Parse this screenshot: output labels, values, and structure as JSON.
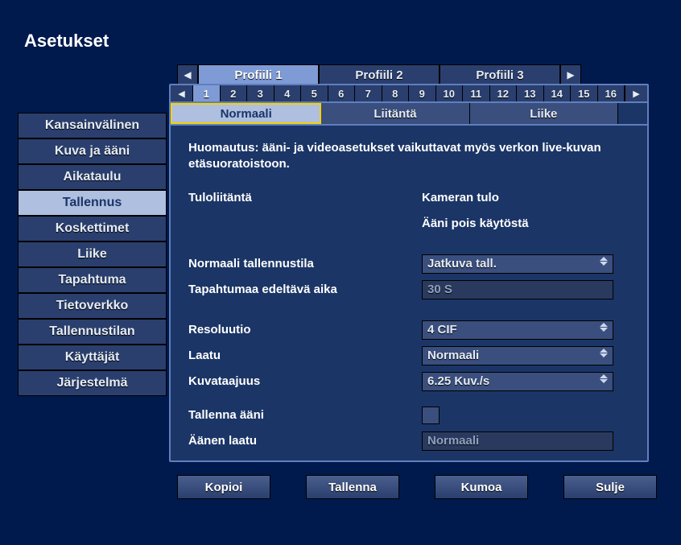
{
  "title": "Asetukset",
  "profiles": {
    "arrow_left": "◀",
    "arrow_right": "▶",
    "tabs": [
      "Profiili 1",
      "Profiili 2",
      "Profiili 3"
    ],
    "active_index": 0
  },
  "channels": {
    "arrow_left": "◀",
    "arrow_right": "▶",
    "numbers": [
      "1",
      "2",
      "3",
      "4",
      "5",
      "6",
      "7",
      "8",
      "9",
      "10",
      "11",
      "12",
      "13",
      "14",
      "15",
      "16"
    ],
    "active_index": 0
  },
  "mode_tabs": {
    "items": [
      "Normaali",
      "Liitäntä",
      "Liike"
    ],
    "active_index": 0
  },
  "sidebar": {
    "items": [
      "Kansainvälinen",
      "Kuva ja ääni",
      "Aikataulu",
      "Tallennus",
      "Koskettimet",
      "Liike",
      "Tapahtuma",
      "Tietoverkko",
      "Tallennustilan",
      "Käyttäjät",
      "Järjestelmä"
    ],
    "active_index": 3
  },
  "content": {
    "note": "Huomautus: ääni- ja videoasetukset vaikuttavat myös verkon live-kuvan etäsuoratoistoon.",
    "input_label": "Tuloliitäntä",
    "input_value1": "Kameran tulo",
    "input_value2": "Ääni pois käytöstä",
    "recmode_label": "Normaali tallennustila",
    "recmode_value": "Jatkuva tall.",
    "preevent_label": "Tapahtumaa edeltävä aika",
    "preevent_value": "30 S",
    "resolution_label": "Resoluutio",
    "resolution_value": "4 CIF",
    "quality_label": "Laatu",
    "quality_value": "Normaali",
    "framerate_label": "Kuvataajuus",
    "framerate_value": "6.25 Kuv./s",
    "recaudio_label": "Tallenna ääni",
    "audioqual_label": "Äänen laatu",
    "audioqual_value": "Normaali"
  },
  "buttons": {
    "copy": "Kopioi",
    "save": "Tallenna",
    "undo": "Kumoa",
    "close": "Sulje"
  }
}
